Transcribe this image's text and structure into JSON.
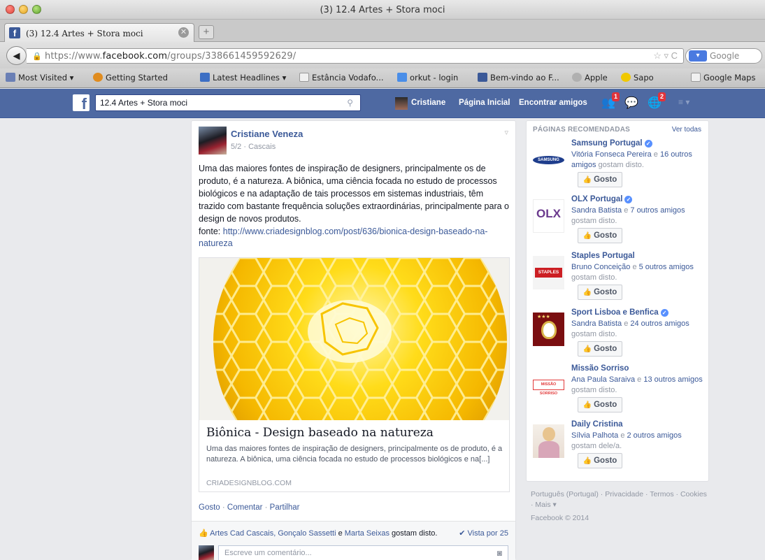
{
  "window": {
    "title": "(3) 12.4 Artes + Stora moci"
  },
  "tabs": [
    {
      "label": "(3) 12.4 Artes + Stora moci",
      "favicon": "f"
    }
  ],
  "toolbar": {
    "back_icon": "◀",
    "url_scheme_host": "https://www.",
    "url_domain": "facebook.com",
    "url_path": "/groups/338661459592629/",
    "url_icons": "☆ ▿ C",
    "search_placeholder": "Google",
    "search_engine_icon": "▾"
  },
  "bookmarks": [
    {
      "label": "Most Visited ▾",
      "color": "#6a7fb5"
    },
    {
      "label": "Getting Started",
      "color": "#e08c1f"
    },
    {
      "label": "Latest Headlines ▾",
      "color": "#3d6fc4"
    },
    {
      "label": "Estância Vodafo...",
      "color": "#e8e8e8"
    },
    {
      "label": "orkut - login",
      "color": "#4a8ee8"
    },
    {
      "label": "Bem-vindo ao F...",
      "color": "#3b5998"
    },
    {
      "label": "Apple",
      "color": "#b0b0b0"
    },
    {
      "label": "Sapo",
      "color": "#f0c800"
    },
    {
      "label": "Google Maps",
      "color": "#e8e8e8"
    }
  ],
  "fb_header": {
    "logo": "f",
    "search_value": "12.4 Artes + Stora moci",
    "nav": [
      "Cristiane",
      "Página Inicial",
      "Encontrar amigos"
    ],
    "friend_badge": "1",
    "notif_badge": "2"
  },
  "post": {
    "author": "Cristiane Veneza",
    "meta": "5/2 · Cascais",
    "text": "Uma das maiores fontes de inspiração de designers, principalmente os de produto, é a natureza. A biônica, uma ciência focada no estudo de processos biológicos e na adaptação de tais processos em sistemas industriais, têm trazido com bastante frequência soluções extraordinárias, principalmente para o design de novos produtos.",
    "link_prefix": "fonte: ",
    "link": "http://www.criadesignblog.com/post/636/bionica-design-baseado-na-natureza",
    "share": {
      "title": "Biônica - Design baseado na natureza",
      "description": "Uma das maiores fontes de inspiração de designers, principalmente os de produto, é a natureza. A biônica, uma ciência focada no estudo de processos biológicos e na[...]",
      "domain": "CRIADESIGNBLOG.COM"
    },
    "actions": [
      "Gosto",
      "Comentar",
      "Partilhar"
    ],
    "likes": {
      "names_a": "Artes Cad Cascais, Gonçalo Sassetti",
      "joiner": " e ",
      "names_b": "Marta Seixas",
      "suffix": " gostam disto."
    },
    "seen_by": "✔ Vista por 25",
    "comment_placeholder": "Escreve um comentário..."
  },
  "pages": {
    "header": "PÁGINAS RECOMENDADAS",
    "see_all": "Ver todas",
    "like_label": "Gosto",
    "items": [
      {
        "name": "Samsung Portugal",
        "verified": true,
        "friends_a": "Vitória Fonseca Pereira",
        "mid": " e ",
        "friends_b": "16 outros amigos",
        "tail": " gostam disto."
      },
      {
        "name": "OLX Portugal",
        "verified": true,
        "friends_a": "Sandra Batista",
        "mid": " e ",
        "friends_b": "7 outros amigos",
        "tail": " gostam disto."
      },
      {
        "name": "Staples Portugal",
        "verified": false,
        "friends_a": "Bruno Conceição",
        "mid": " e ",
        "friends_b": "5 outros amigos",
        "tail": " gostam disto."
      },
      {
        "name": "Sport Lisboa e Benfica",
        "verified": true,
        "friends_a": "Sandra Batista",
        "mid": " e ",
        "friends_b": "24 outros amigos",
        "tail": " gostam disto."
      },
      {
        "name": "Missão Sorriso",
        "verified": false,
        "friends_a": "Ana Paula Saraiva",
        "mid": " e ",
        "friends_b": "13 outros amigos",
        "tail": " gostam disto."
      },
      {
        "name": "Daily Cristina",
        "verified": false,
        "friends_a": "Sílvia Palhota",
        "mid": " e ",
        "friends_b": "2 outros amigos",
        "tail": " gostam dele/a."
      }
    ],
    "logo_texts": [
      "SAMSUNG",
      "OLX",
      "STAPLES",
      "",
      "MISSÃO SORRISO",
      ""
    ]
  },
  "footer": {
    "links": "Português (Portugal) · Privacidade · Termos · Cookies · Mais ▾",
    "copyright": "Facebook © 2014"
  }
}
